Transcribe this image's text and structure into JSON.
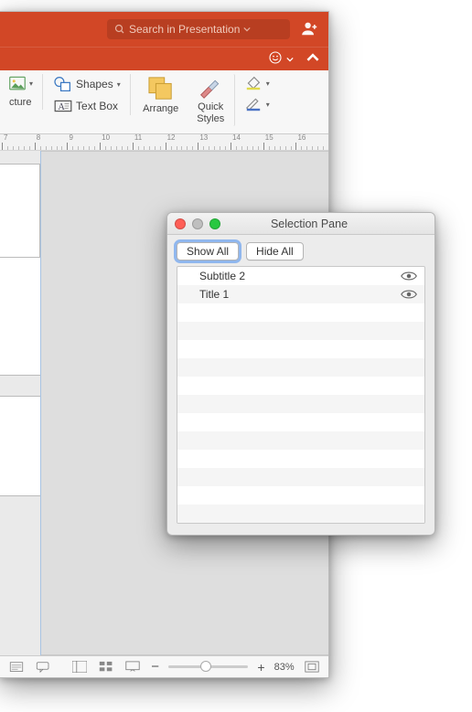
{
  "search": {
    "placeholder": "Search in Presentation"
  },
  "ribbon": {
    "picture_dd": "cture",
    "shapes": "Shapes",
    "textbox": "Text Box",
    "arrange": "Arrange",
    "quick_styles": "Quick\nStyles"
  },
  "ruler_marks": [
    "7",
    "8",
    "9",
    "10",
    "11",
    "12",
    "13",
    "14",
    "15",
    "16"
  ],
  "status": {
    "zoom_label": "83%"
  },
  "panel": {
    "title": "Selection Pane",
    "show_all": "Show All",
    "hide_all": "Hide All",
    "items": [
      {
        "label": "Subtitle 2",
        "visible": true
      },
      {
        "label": "Title 1",
        "visible": true
      }
    ]
  }
}
